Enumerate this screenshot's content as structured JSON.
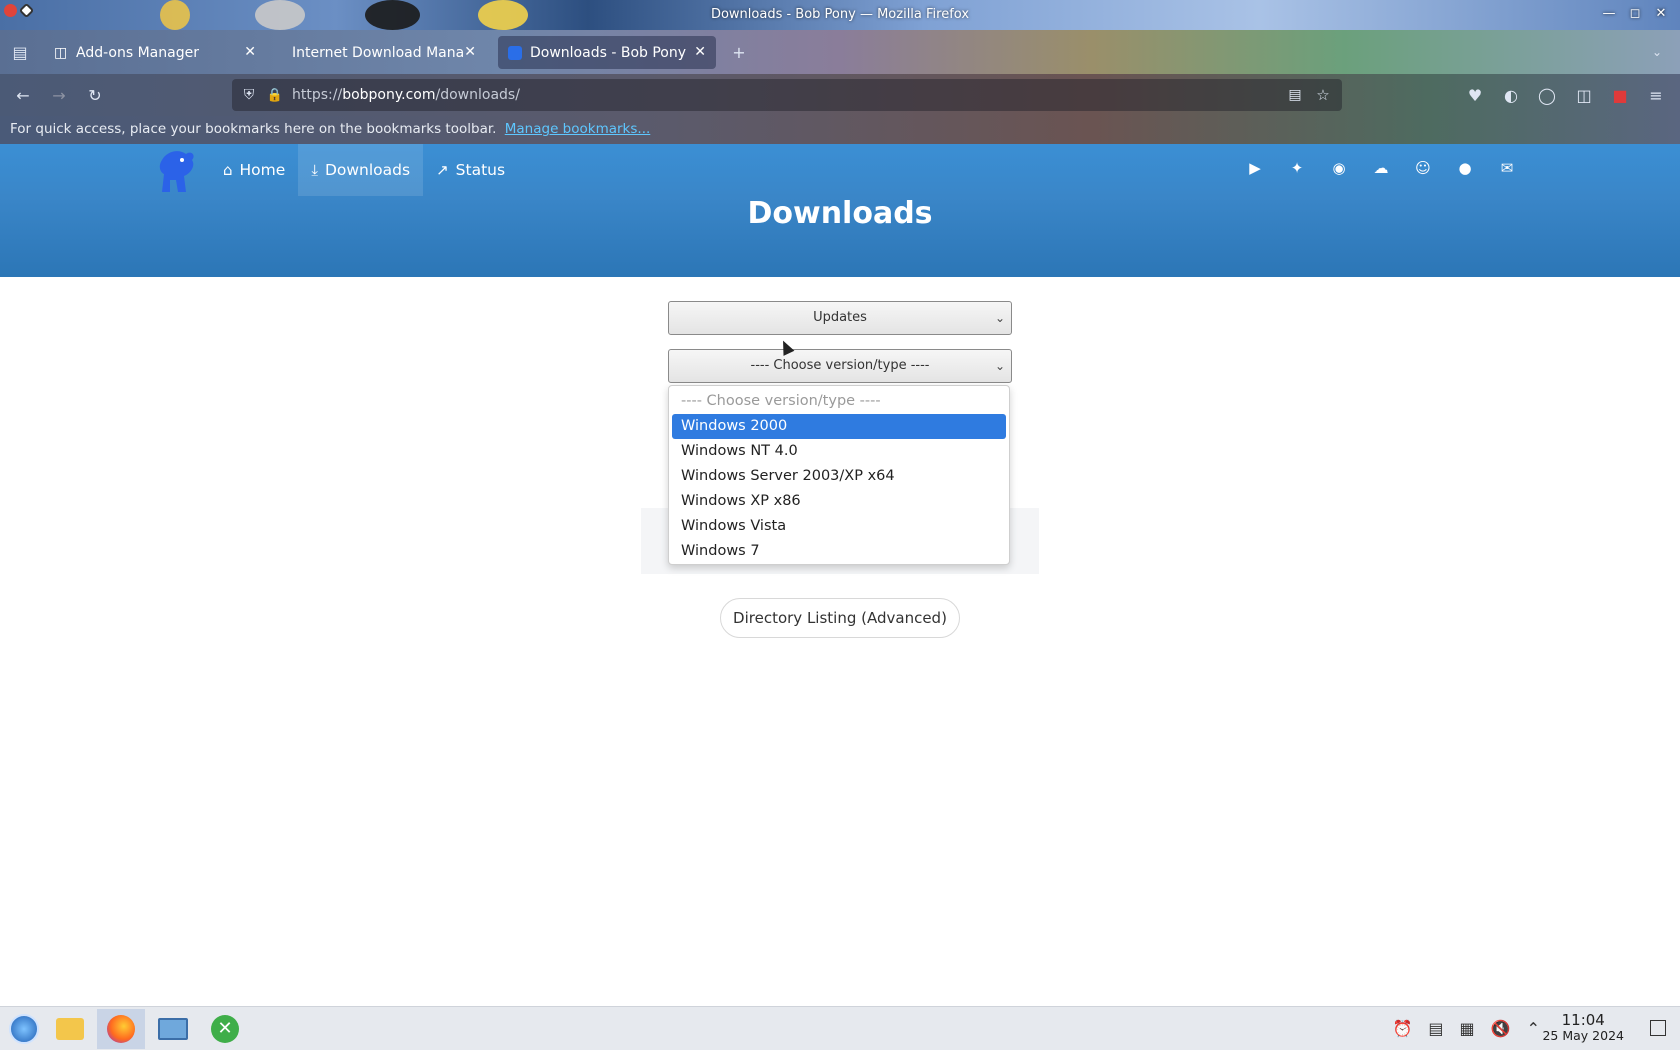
{
  "window": {
    "title": "Downloads - Bob Pony — Mozilla Firefox",
    "controls": [
      "minimize",
      "maximize",
      "close"
    ]
  },
  "tabs": [
    {
      "label": "Add-ons Manager",
      "icon": "puzzle-icon",
      "active": false
    },
    {
      "label": "Internet Download Mana",
      "icon": "",
      "active": false
    },
    {
      "label": "Downloads - Bob Pony",
      "icon": "bobpony-favicon",
      "active": true
    }
  ],
  "toolbar": {
    "url_domain": "bobpony.com",
    "url_prefix": "https://",
    "url_path": "/downloads/"
  },
  "bookmarks_bar": {
    "message": "For quick access, place your bookmarks here on the bookmarks toolbar.",
    "link": "Manage bookmarks..."
  },
  "site": {
    "nav": [
      {
        "label": "Home",
        "icon": "home-icon"
      },
      {
        "label": "Downloads",
        "icon": "download-icon"
      },
      {
        "label": "Status",
        "icon": "trend-icon"
      }
    ],
    "social": [
      "youtube-icon",
      "twitter-icon",
      "mastodon-icon",
      "cloud-icon",
      "discord-icon",
      "github-icon",
      "mail-icon"
    ],
    "page_title": "Downloads"
  },
  "form": {
    "category_select": "Updates",
    "version_select": "---- Choose version/type ----",
    "options": [
      "---- Choose version/type ----",
      "Windows 2000",
      "Windows NT 4.0",
      "Windows Server 2003/XP x64",
      "Windows XP x86",
      "Windows Vista",
      "Windows 7"
    ],
    "highlighted_option": "Windows 2000",
    "directory_button": "Directory Listing (Advanced)"
  },
  "taskbar": {
    "time": "11:04",
    "date": "25 May 2024"
  },
  "colors": {
    "site_blue": "#3a86c8",
    "option_highlight": "#2f7be0",
    "link": "#5ec7ff"
  }
}
